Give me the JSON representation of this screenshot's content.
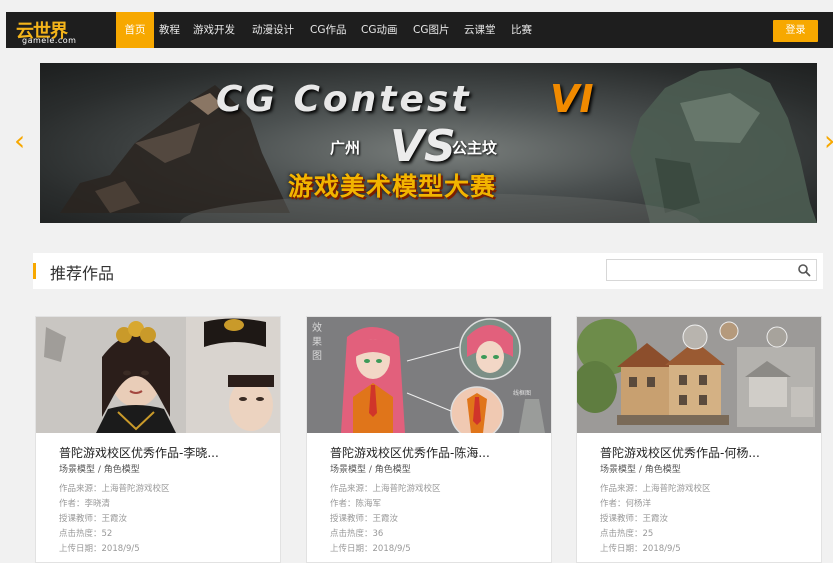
{
  "logo": {
    "main": "云世界",
    "sub": "gamele.com"
  },
  "nav": {
    "items": [
      "首页",
      "教程",
      "游戏开发",
      "动漫设计",
      "CG作品",
      "CG动画",
      "CG图片",
      "云课堂",
      "比赛"
    ],
    "login_label": "登录"
  },
  "banner": {
    "title": "CG Contest",
    "title_number": "VI",
    "left_team": "广州",
    "vs": "VS",
    "right_team": "公主坟",
    "subtitle": "游戏美术模型大赛"
  },
  "section": {
    "title": "推荐作品",
    "search_placeholder": ""
  },
  "cards": [
    {
      "title": "普陀游戏校区优秀作品-李晓...",
      "category": "场景模型 / 角色模型",
      "source": "作品来源：上海普陀游戏校区",
      "author": "作者：李晓清",
      "teacher": "授课教师：王霞汝",
      "views": "点击热度：52",
      "date": "上传日期：2018/9/5"
    },
    {
      "title": "普陀游戏校区优秀作品-陈海...",
      "category": "场景模型 / 角色模型",
      "source": "作品来源：上海普陀游戏校区",
      "author": "作者：陈海军",
      "teacher": "授课教师：王霞汝",
      "views": "点击热度：36",
      "date": "上传日期：2018/9/5",
      "image_text": [
        "效",
        "果",
        "图"
      ],
      "image_tag": "线框图"
    },
    {
      "title": "普陀游戏校区优秀作品-何杨...",
      "category": "场景模型 / 角色模型",
      "source": "作品来源：上海普陀游戏校区",
      "author": "作者：何杨洋",
      "teacher": "授课教师：王霞汝",
      "views": "点击热度：25",
      "date": "上传日期：2018/9/5"
    }
  ],
  "colors": {
    "accent": "#f7a800",
    "nav_bg": "#1e1e1e",
    "page_bg": "#f1f1f1"
  },
  "icons": {
    "prev": "chevron-left-icon",
    "next": "chevron-right-icon",
    "search": "search-icon"
  }
}
